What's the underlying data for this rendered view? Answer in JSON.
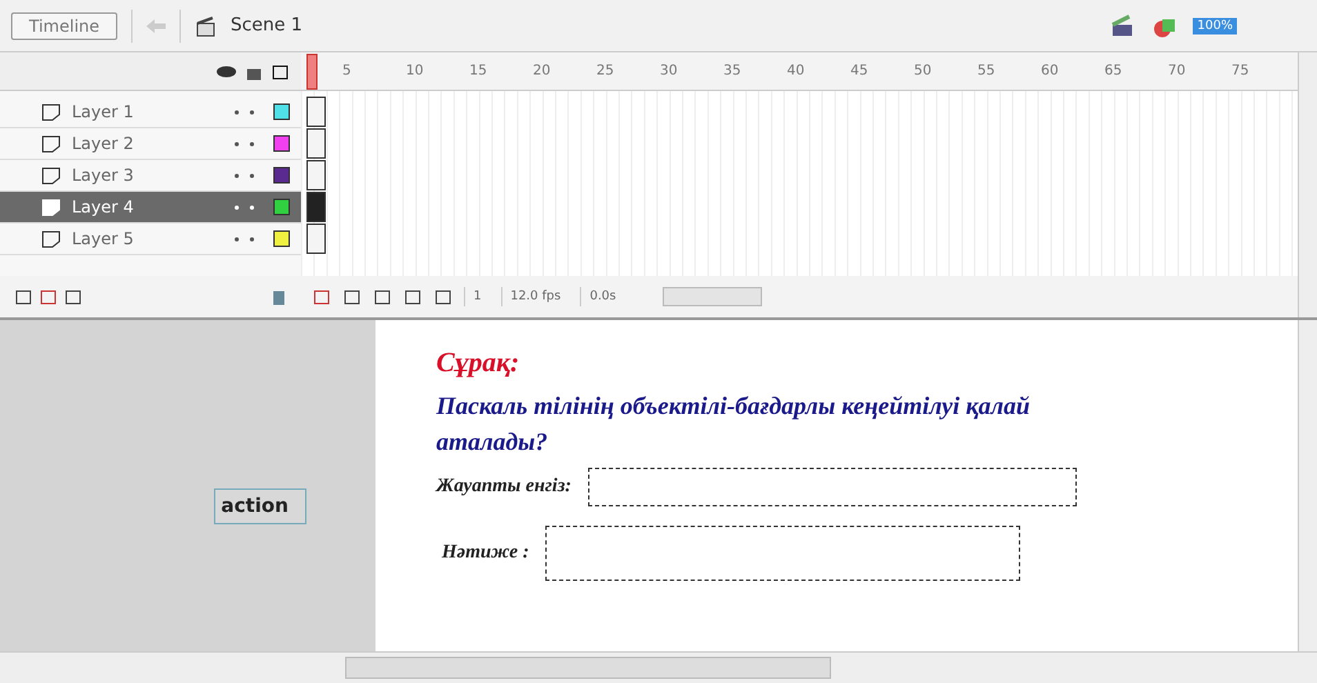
{
  "toolbar": {
    "timeline_button": "Timeline",
    "scene": "Scene 1",
    "zoom": "100%"
  },
  "ruler": [
    "5",
    "10",
    "15",
    "20",
    "25",
    "30",
    "35",
    "40",
    "45",
    "50",
    "55",
    "60",
    "65",
    "70",
    "75"
  ],
  "layers": [
    {
      "name": "Layer 1",
      "color": "#4fe0e8",
      "selected": false
    },
    {
      "name": "Layer 2",
      "color": "#f040f0",
      "selected": false
    },
    {
      "name": "Layer 3",
      "color": "#5a2a90",
      "selected": false
    },
    {
      "name": "Layer 4",
      "color": "#30d040",
      "selected": true
    },
    {
      "name": "Layer 5",
      "color": "#f0f040",
      "selected": false
    }
  ],
  "frame_bar": {
    "current_frame": "1",
    "fps": "12.0 fps",
    "time": "0.0s"
  },
  "stage": {
    "button": "action",
    "question_label": "Сұрақ:",
    "question": "Паскаль тілінің объектілі-бағдарлы кеңейтілуі қалай аталады?",
    "input_label": "Жауапты енгіз:",
    "result_label": "Нәтиже :"
  }
}
